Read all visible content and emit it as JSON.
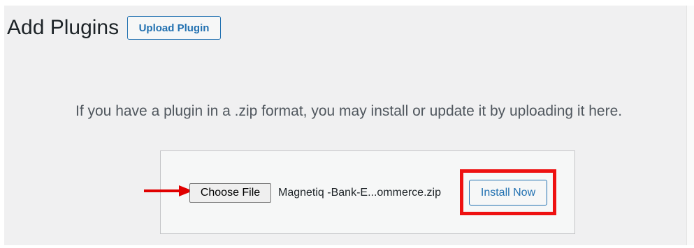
{
  "page": {
    "title": "Add Plugins",
    "upload_button": "Upload Plugin",
    "help_text": "If you have a plugin in a .zip format, you may install or update it by uploading it here."
  },
  "upload_form": {
    "choose_file_label": "Choose File",
    "selected_file": "Magnetiq -Bank-E...ommerce.zip",
    "install_button": "Install Now"
  },
  "annotations": {
    "arrow_icon": "red-arrow-right-icon",
    "arrow_color": "#e00000",
    "highlight_color": "#ee1111"
  }
}
